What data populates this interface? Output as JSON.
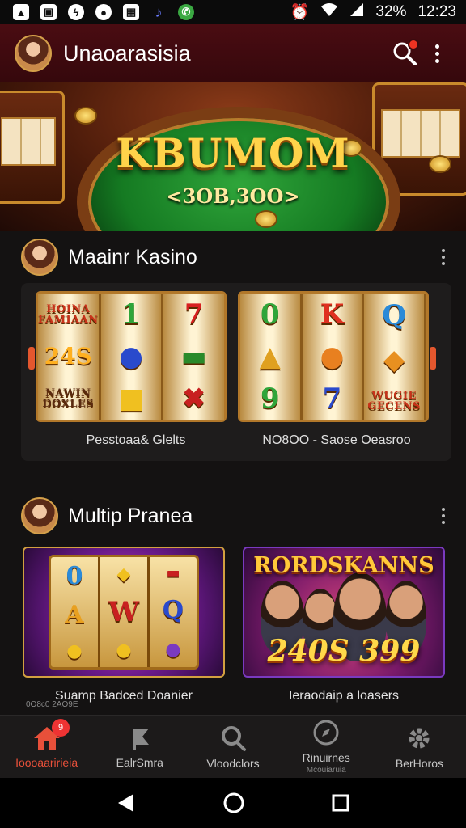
{
  "status_bar": {
    "time": "12:23",
    "battery": "32%",
    "left_icons": [
      "alert-icon",
      "image-icon",
      "messenger-icon",
      "chat-icon",
      "photo-icon",
      "music-icon",
      "whatsapp-icon"
    ],
    "right_icons": [
      "alarm-icon",
      "wifi-icon",
      "signal-icon"
    ]
  },
  "app_bar": {
    "title": "Unaoarasisia"
  },
  "banner": {
    "title": "KBUMOM",
    "subtitle": "<3OB,3OO>"
  },
  "section1": {
    "title": "Maainr Kasino",
    "reels_left": {
      "col1": [
        "HOINA\nFAMIAAN",
        "24S",
        "NAWIN\nDOXLES"
      ],
      "col2": [
        "1",
        "",
        ""
      ],
      "col3": [
        "7",
        "",
        ""
      ]
    },
    "reels_right": {
      "col1": [
        "0",
        "",
        "9"
      ],
      "col2": [
        "K",
        "",
        "7"
      ],
      "col3": [
        "Q",
        "",
        "WUGIE\nGECENS"
      ]
    },
    "label_left": "Pesstoaa& Glelts",
    "label_right": "NO8OO - Saose Oeasroo"
  },
  "section2": {
    "title": "Multip Pranea",
    "game1": {
      "label": "Suamp Badced Doanier",
      "symbols": [
        "0",
        "A",
        "W",
        "Q"
      ]
    },
    "game2": {
      "title": "RORDSKANNS",
      "number": "240S 399",
      "label": "Ieraodaip a loasers"
    },
    "tiny_note": "0O8c0 2AO9E"
  },
  "bottom_nav": {
    "items": [
      {
        "label": "Ioooaaririeia",
        "icon": "home-icon",
        "active": true,
        "badge": "9"
      },
      {
        "label": "EalrSmra",
        "icon": "flag-icon",
        "active": false
      },
      {
        "label": "Vloodclors",
        "icon": "search-icon",
        "active": false
      },
      {
        "label": "Rinuirnes",
        "sub": "Mcouiaruia",
        "icon": "compass-icon",
        "active": false
      },
      {
        "label": "BerHoros",
        "icon": "gear-icon",
        "active": false
      }
    ]
  },
  "colors": {
    "app_bar": "#4a0c12",
    "accent": "#e8503a",
    "background": "#141212"
  }
}
